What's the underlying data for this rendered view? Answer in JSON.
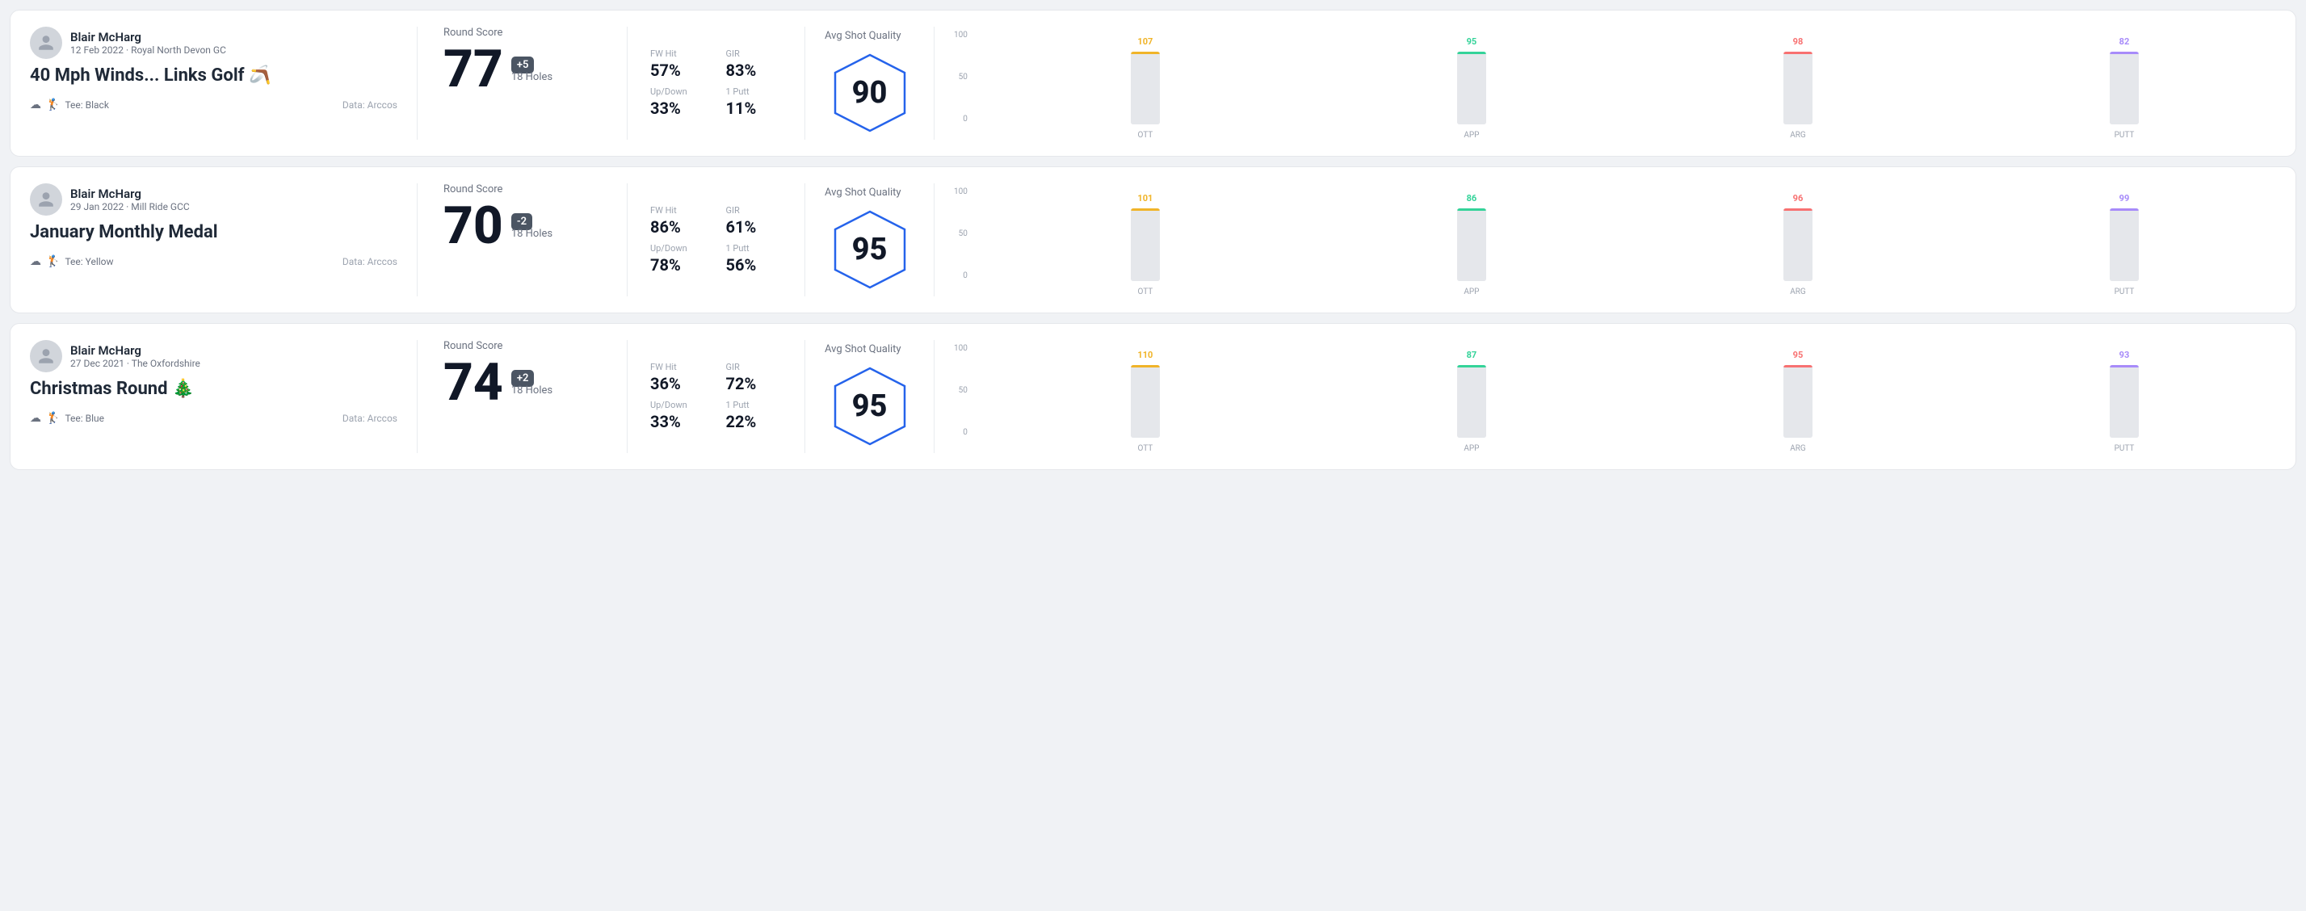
{
  "rounds": [
    {
      "id": "round1",
      "user": {
        "name": "Blair McHarg",
        "date": "12 Feb 2022 · Royal North Devon GC"
      },
      "title": "40 Mph Winds... Links Golf 🪃",
      "tee": "Tee: Black",
      "data_source": "Data: Arccos",
      "round_score_label": "Round Score",
      "score": "77",
      "score_diff": "+5",
      "holes": "18 Holes",
      "fw_hit_label": "FW Hit",
      "fw_hit": "57%",
      "gir_label": "GIR",
      "gir": "83%",
      "updown_label": "Up/Down",
      "updown": "33%",
      "oneputt_label": "1 Putt",
      "oneputt": "11%",
      "avg_quality_label": "Avg Shot Quality",
      "quality_score": "90",
      "chart": {
        "bars": [
          {
            "label": "OTT",
            "value": 107,
            "color": "#f0b429",
            "height_pct": 72
          },
          {
            "label": "APP",
            "value": 95,
            "color": "#34d399",
            "height_pct": 62
          },
          {
            "label": "ARG",
            "value": 98,
            "color": "#f87171",
            "height_pct": 65
          },
          {
            "label": "PUTT",
            "value": 82,
            "color": "#a78bfa",
            "height_pct": 52
          }
        ]
      }
    },
    {
      "id": "round2",
      "user": {
        "name": "Blair McHarg",
        "date": "29 Jan 2022 · Mill Ride GCC"
      },
      "title": "January Monthly Medal",
      "tee": "Tee: Yellow",
      "data_source": "Data: Arccos",
      "round_score_label": "Round Score",
      "score": "70",
      "score_diff": "-2",
      "holes": "18 Holes",
      "fw_hit_label": "FW Hit",
      "fw_hit": "86%",
      "gir_label": "GIR",
      "gir": "61%",
      "updown_label": "Up/Down",
      "updown": "78%",
      "oneputt_label": "1 Putt",
      "oneputt": "56%",
      "avg_quality_label": "Avg Shot Quality",
      "quality_score": "95",
      "chart": {
        "bars": [
          {
            "label": "OTT",
            "value": 101,
            "color": "#f0b429",
            "height_pct": 68
          },
          {
            "label": "APP",
            "value": 86,
            "color": "#34d399",
            "height_pct": 56
          },
          {
            "label": "ARG",
            "value": 96,
            "color": "#f87171",
            "height_pct": 64
          },
          {
            "label": "PUTT",
            "value": 99,
            "color": "#a78bfa",
            "height_pct": 66
          }
        ]
      }
    },
    {
      "id": "round3",
      "user": {
        "name": "Blair McHarg",
        "date": "27 Dec 2021 · The Oxfordshire"
      },
      "title": "Christmas Round 🎄",
      "tee": "Tee: Blue",
      "data_source": "Data: Arccos",
      "round_score_label": "Round Score",
      "score": "74",
      "score_diff": "+2",
      "holes": "18 Holes",
      "fw_hit_label": "FW Hit",
      "fw_hit": "36%",
      "gir_label": "GIR",
      "gir": "72%",
      "updown_label": "Up/Down",
      "updown": "33%",
      "oneputt_label": "1 Putt",
      "oneputt": "22%",
      "avg_quality_label": "Avg Shot Quality",
      "quality_score": "95",
      "chart": {
        "bars": [
          {
            "label": "OTT",
            "value": 110,
            "color": "#f0b429",
            "height_pct": 75
          },
          {
            "label": "APP",
            "value": 87,
            "color": "#34d399",
            "height_pct": 57
          },
          {
            "label": "ARG",
            "value": 95,
            "color": "#f87171",
            "height_pct": 63
          },
          {
            "label": "PUTT",
            "value": 93,
            "color": "#a78bfa",
            "height_pct": 62
          }
        ]
      }
    }
  ],
  "labels": {
    "y_axis": [
      "100",
      "50",
      "0"
    ]
  }
}
